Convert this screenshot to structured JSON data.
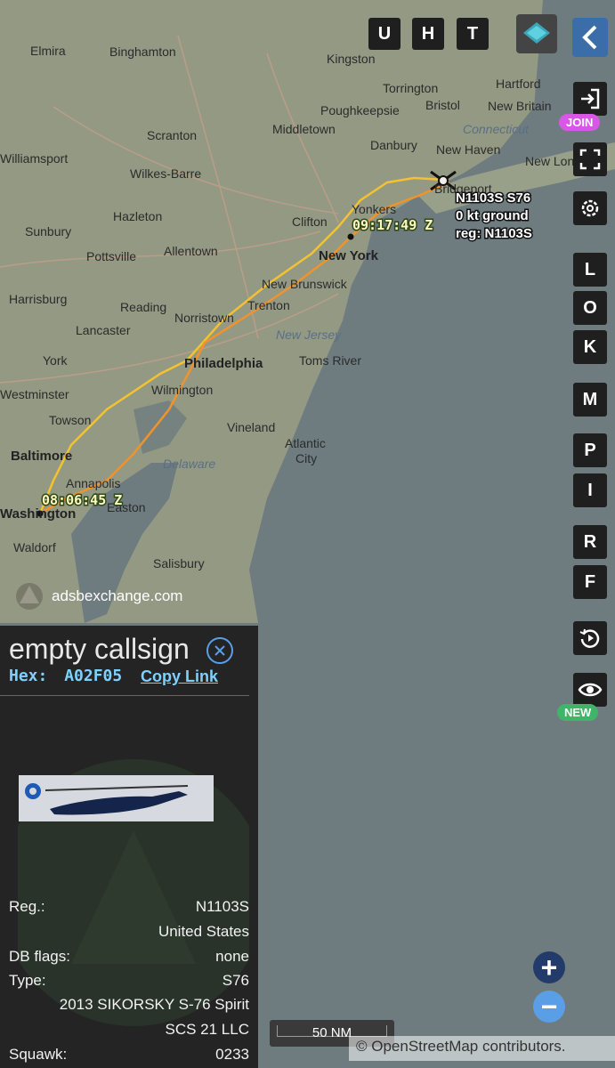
{
  "topbar": {
    "buttons": [
      "U",
      "H",
      "T"
    ]
  },
  "map": {
    "place_labels": [
      "Elmira",
      "Binghamton",
      "Kingston",
      "Torrington",
      "Hartford",
      "Bristol",
      "New Britain",
      "Poughkeepsie",
      "Middletown",
      "Scranton",
      "Connecticut",
      "Danbury",
      "New Haven",
      "Williamsport",
      "Wilkes-Barre",
      "New London",
      "Hazleton",
      "Clifton",
      "Yonkers",
      "Bridgeport",
      "Sunbury",
      "Allentown",
      "New York",
      "Pottsville",
      "Harrisburg",
      "Reading",
      "New Brunswick",
      "Trenton",
      "Lancaster",
      "Norristown",
      "New Jersey",
      "York",
      "Philadelphia",
      "Toms River",
      "Westminster",
      "Wilmington",
      "Towson",
      "Vineland",
      "Baltimore",
      "Atlantic",
      "City",
      "Annapolis",
      "Delaware",
      "Easton",
      "Washington",
      "Waldorf",
      "Salisbury"
    ],
    "aircraft_label": {
      "line1": "N1103S S76",
      "line2": "0 kt  ground",
      "line3": "reg: N1103S"
    },
    "timestamps": [
      "09:17:49 Z",
      "08:06:45 Z"
    ],
    "watermark": "adsbexchange.com",
    "scale": "50 NM",
    "attribution": "© OpenStreetMap contributors."
  },
  "sidebar": {
    "join_badge": "JOIN",
    "letters": [
      "L",
      "O",
      "K",
      "M",
      "P",
      "I",
      "R",
      "F"
    ],
    "new_badge": "NEW"
  },
  "zoom": {
    "in": "+",
    "out": "−"
  },
  "panel": {
    "callsign": "empty callsign",
    "hex_label": "Hex:",
    "hex_value": "A02F05",
    "copy_link": "Copy Link",
    "rows": [
      {
        "label": "Reg.:",
        "value": "N1103S"
      },
      {
        "label": "",
        "value": "United States"
      },
      {
        "label": "DB flags:",
        "value": "none"
      },
      {
        "label": "Type:",
        "value": "S76"
      },
      {
        "label": "",
        "value": "2013 SIKORSKY S-76 Spirit"
      },
      {
        "label": "",
        "value": "SCS 21 LLC"
      },
      {
        "label": "Squawk:",
        "value": "0233"
      }
    ]
  },
  "colors": {
    "track_yellow": "#f2c230",
    "track_orange": "#f0932b",
    "panel_bg": "#242424",
    "water": "#6e7c80",
    "join": "#d957e6",
    "new": "#3fb56a",
    "zoom": "#4a90d9"
  }
}
